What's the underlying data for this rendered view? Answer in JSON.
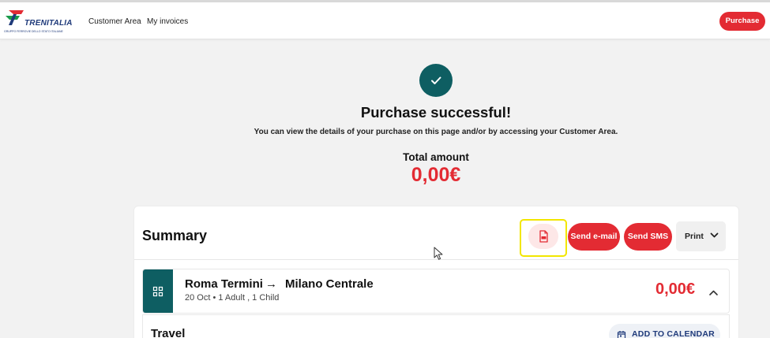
{
  "brand": {
    "name": "TRENITALIA",
    "tagline": "GRUPPO FERROVIE DELLO STATO ITALIANE",
    "color": "#1f3a7a",
    "accent": "#e32b33"
  },
  "nav": {
    "links": [
      "Customer Area",
      "My invoices"
    ],
    "purchase_label": "Purchase"
  },
  "confirmation": {
    "icon": "checkmark-icon",
    "title": "Purchase successful!",
    "subtitle": "You can view the details of your purchase on this page and/or by accessing your Customer Area.",
    "total_label": "Total amount",
    "total_value": "0,00€"
  },
  "summary": {
    "title": "Summary",
    "actions": {
      "pdf_icon": "pdf-file-icon",
      "email": "Send e-mail",
      "sms": "Send SMS",
      "print": "Print"
    }
  },
  "trip": {
    "from": "Roma Termini",
    "arrow": "→",
    "to": "Milano Centrale",
    "details": "20 Oct • 1 Adult , 1 Child",
    "price": "0,00€"
  },
  "travel": {
    "label": "Travel",
    "add_to_calendar": "ADD TO CALENDAR"
  },
  "colors": {
    "teal": "#0e5e62",
    "red": "#e32b33",
    "highlight": "#f2e600"
  }
}
